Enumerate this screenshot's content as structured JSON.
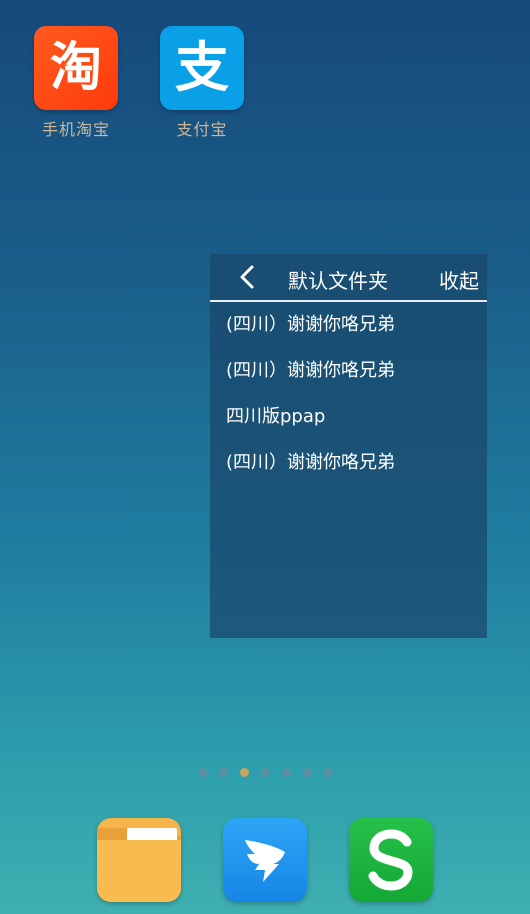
{
  "desktop": {
    "apps": [
      {
        "label": "手机淘宝",
        "glyph": "淘",
        "icon": "taobao-icon",
        "color": "#ff4a12"
      },
      {
        "label": "支付宝",
        "glyph": "支",
        "icon": "alipay-icon",
        "color": "#0aa0e8"
      }
    ]
  },
  "folder": {
    "title": "默认文件夹",
    "collapse_label": "收起",
    "items": [
      "(四川）谢谢你咯兄弟",
      "(四川）谢谢你咯兄弟",
      "四川版ppap",
      "(四川）谢谢你咯兄弟"
    ]
  },
  "page_indicator": {
    "total": 7,
    "current": 3
  },
  "dock": {
    "apps": [
      {
        "icon": "file-manager-icon",
        "color": "#f4b54a"
      },
      {
        "icon": "dingtalk-icon",
        "color": "#1e93ee"
      },
      {
        "icon": "wps-icon",
        "color": "#1eb53f"
      }
    ]
  }
}
